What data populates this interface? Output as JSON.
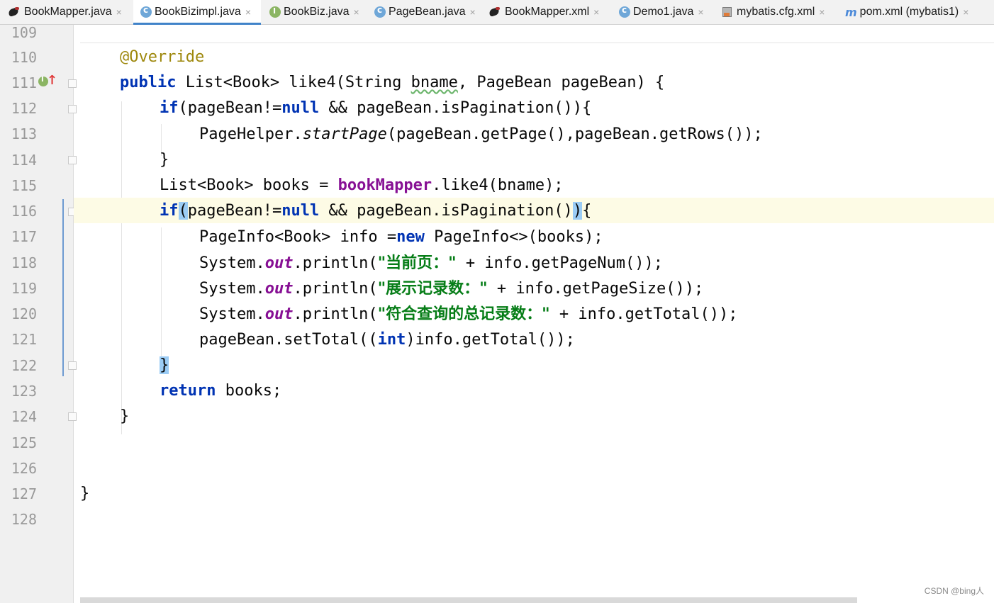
{
  "tabs": [
    {
      "label": "BookMapper.java",
      "icon": "mybatis-bird-icon"
    },
    {
      "label": "BookBizimpl.java",
      "icon": "class-icon",
      "active": true
    },
    {
      "label": "BookBiz.java",
      "icon": "interface-icon"
    },
    {
      "label": "PageBean.java",
      "icon": "class-icon"
    },
    {
      "label": "BookMapper.xml",
      "icon": "mybatis-bird-icon"
    },
    {
      "label": "Demo1.java",
      "icon": "class-icon"
    },
    {
      "label": "mybatis.cfg.xml",
      "icon": "config-file-icon"
    },
    {
      "label": "pom.xml (mybatis1)",
      "icon": "maven-icon"
    }
  ],
  "close_glyph": "×",
  "line_numbers": [
    "109",
    "110",
    "111",
    "112",
    "113",
    "114",
    "115",
    "116",
    "117",
    "118",
    "119",
    "120",
    "121",
    "122",
    "123",
    "124",
    "125",
    "126",
    "127",
    "128"
  ],
  "code": {
    "l110": {
      "t0": "@Override"
    },
    "l111": {
      "t0": "public",
      "t1": " List<Book> like4(String ",
      "t2": "bname",
      "t3": ", PageBean pageBean) {"
    },
    "l112": {
      "t0": "if",
      "t1": "(pageBean!=",
      "t2": "null",
      "t3": " && pageBean.isPagination()){"
    },
    "l113": {
      "t0": "PageHelper.",
      "t1": "startPage",
      "t2": "(pageBean.getPage(),pageBean.getRows());"
    },
    "l114": {
      "t0": "}"
    },
    "l115": {
      "t0": "List<Book> books = ",
      "t1": "bookMapper",
      "t2": ".like4(bname);"
    },
    "l116": {
      "t0": "if",
      "t1": "(",
      "t2": "pageBean!=",
      "t3": "null",
      "t4": " && pageBean.isPagination()",
      "t5": ")",
      "t6": "{"
    },
    "l117": {
      "t0": "PageInfo<Book> info =",
      "t1": "new",
      "t2": " PageInfo<>(books);"
    },
    "l118": {
      "t0": "System.",
      "t1": "out",
      "t2": ".println(",
      "t3": "\"当前页：\"",
      "t4": " + info.getPageNum());"
    },
    "l119": {
      "t0": "System.",
      "t1": "out",
      "t2": ".println(",
      "t3": "\"展示记录数：\"",
      "t4": " + info.getPageSize());"
    },
    "l120": {
      "t0": "System.",
      "t1": "out",
      "t2": ".println(",
      "t3": "\"符合查询的总记录数：\"",
      "t4": " + info.getTotal());"
    },
    "l121": {
      "t0": "pageBean.setTotal((",
      "t1": "int",
      "t2": ")info.getTotal());"
    },
    "l122": {
      "t0": "}"
    },
    "l123": {
      "t0": "return",
      "t1": " books;"
    },
    "l124": {
      "t0": "}"
    },
    "l127": {
      "t0": "}"
    }
  },
  "gutter_markers": {
    "implements_badge": "I",
    "override_arrow": "↑"
  },
  "watermark": "CSDN @bing人",
  "colors": {
    "keyword": "#0033b3",
    "annotation": "#9e880d",
    "field": "#871094",
    "string": "#067d17",
    "current_line": "#fdfbe5",
    "brace_match": "#9bccf5",
    "tab_underline": "#4083c9"
  }
}
